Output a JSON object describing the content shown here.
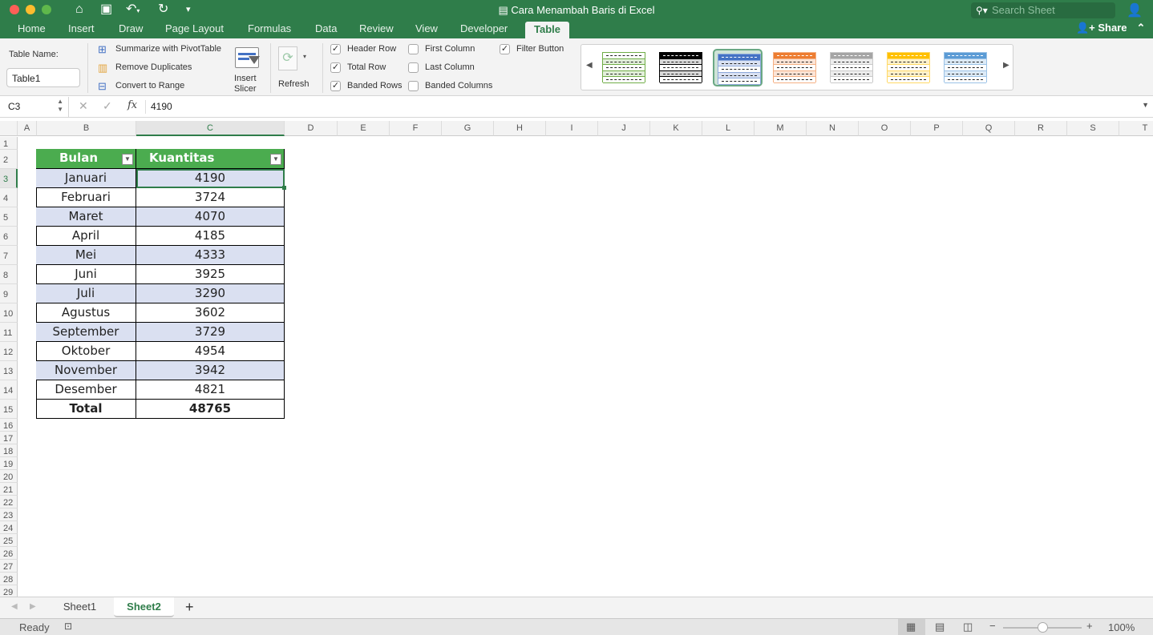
{
  "window": {
    "title": "Cara Menambah Baris di Excel"
  },
  "quick_access": {
    "home": "home-icon",
    "save": "save-icon",
    "undo": "undo-icon",
    "redo": "redo-icon",
    "customize": "customize-icon"
  },
  "search": {
    "placeholder": "Search Sheet"
  },
  "ribbon_tabs": [
    "Home",
    "Insert",
    "Draw",
    "Page Layout",
    "Formulas",
    "Data",
    "Review",
    "View",
    "Developer",
    "Table"
  ],
  "active_tab": "Table",
  "share_label": "Share",
  "ribbon": {
    "table_name_label": "Table Name:",
    "table_name_value": "Table1",
    "tools": {
      "summarize": "Summarize with PivotTable",
      "remove_dup": "Remove Duplicates",
      "convert": "Convert to Range"
    },
    "insert_slicer": [
      "Insert",
      "Slicer"
    ],
    "refresh": "Refresh",
    "options": [
      {
        "label": "Header Row",
        "checked": true
      },
      {
        "label": "Total Row",
        "checked": true
      },
      {
        "label": "Banded Rows",
        "checked": true
      },
      {
        "label": "First Column",
        "checked": false
      },
      {
        "label": "Last Column",
        "checked": false
      },
      {
        "label": "Banded Columns",
        "checked": false
      },
      {
        "label": "Filter Button",
        "checked": true
      }
    ],
    "styles": [
      {
        "name": "green-light",
        "header": "#ffffff",
        "band": "#e2efda",
        "border": "#70ad47",
        "selected": false
      },
      {
        "name": "black",
        "header": "#000000",
        "band": "#d9d9d9",
        "border": "#000000",
        "selected": false
      },
      {
        "name": "blue-medium",
        "header": "#4472c4",
        "band": "#d9e1f2",
        "border": "#8ea9db",
        "selected": true
      },
      {
        "name": "orange",
        "header": "#ed7d31",
        "band": "#fce4d6",
        "border": "#f4b084",
        "selected": false
      },
      {
        "name": "gray",
        "header": "#a5a5a5",
        "band": "#ededed",
        "border": "#c9c9c9",
        "selected": false
      },
      {
        "name": "gold",
        "header": "#ffc000",
        "band": "#fff2cc",
        "border": "#ffd966",
        "selected": false
      },
      {
        "name": "blue-light",
        "header": "#5b9bd5",
        "band": "#ddebf7",
        "border": "#9bc2e6",
        "selected": false
      }
    ]
  },
  "formula_bar": {
    "name_box": "C3",
    "value": "4190",
    "fx": "fx",
    "cancel": "✕",
    "enter": "✓"
  },
  "columns": [
    "A",
    "B",
    "C",
    "D",
    "E",
    "F",
    "G",
    "H",
    "I",
    "J",
    "K",
    "L",
    "M",
    "N",
    "O",
    "P",
    "Q",
    "R",
    "S",
    "T"
  ],
  "selected_column": "C",
  "selected_row": 3,
  "table": {
    "headers": [
      "Bulan",
      "Kuantitas Penjualan"
    ],
    "rows": [
      [
        "Januari",
        "4190"
      ],
      [
        "Februari",
        "3724"
      ],
      [
        "Maret",
        "4070"
      ],
      [
        "April",
        "4185"
      ],
      [
        "Mei",
        "4333"
      ],
      [
        "Juni",
        "3925"
      ],
      [
        "Juli",
        "3290"
      ],
      [
        "Agustus",
        "3602"
      ],
      [
        "September",
        "3729"
      ],
      [
        "Oktober",
        "4954"
      ],
      [
        "November",
        "3942"
      ],
      [
        "Desember",
        "4821"
      ]
    ],
    "total": [
      "Total",
      "48765"
    ],
    "header_color": "#4bac4f",
    "band_color": "#dae0f1"
  },
  "sheets": [
    "Sheet1",
    "Sheet2"
  ],
  "active_sheet": "Sheet2",
  "status": {
    "ready": "Ready",
    "zoom": "100%",
    "zoom_level_pct": 100
  }
}
